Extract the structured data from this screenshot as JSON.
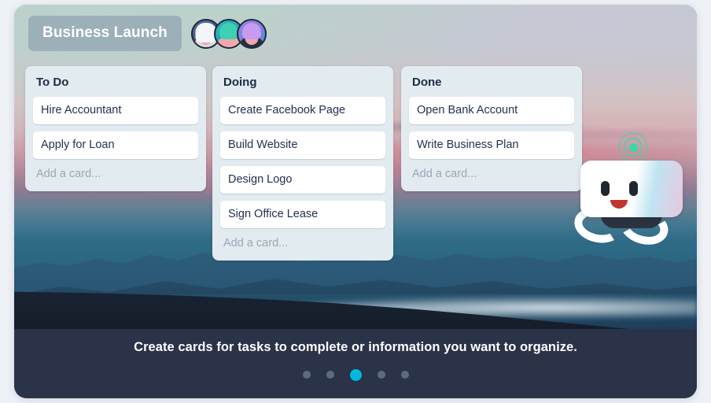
{
  "board": {
    "title": "Business Launch",
    "members": [
      {
        "name": "member-avatar-1"
      },
      {
        "name": "member-avatar-2"
      },
      {
        "name": "member-avatar-3"
      }
    ],
    "columns": [
      {
        "title": "To Do",
        "add_card_label": "Add a card...",
        "cards": [
          {
            "text": "Hire Accountant"
          },
          {
            "text": "Apply for Loan"
          }
        ]
      },
      {
        "title": "Doing",
        "add_card_label": "Add a card...",
        "cards": [
          {
            "text": "Create Facebook Page"
          },
          {
            "text": "Build Website"
          },
          {
            "text": "Design Logo"
          },
          {
            "text": "Sign Office Lease"
          }
        ]
      },
      {
        "title": "Done",
        "add_card_label": "Add a card...",
        "cards": [
          {
            "text": "Open Bank Account"
          },
          {
            "text": "Write Business Plan"
          }
        ]
      }
    ]
  },
  "mascot": {
    "name": "robot-mascot",
    "beacon_color": "#3ad7aa"
  },
  "footer": {
    "caption": "Create cards for tasks to complete or information you want to organize.",
    "pagination": {
      "total": 5,
      "active_index": 2,
      "active_color": "#00b8e0",
      "inactive_color": "#5d6b82"
    }
  },
  "theme": {
    "footer_bg": "#2b3348",
    "column_bg": "#e2ebf0",
    "card_bg": "#ffffff",
    "card_text": "#1f3050",
    "title_pill_bg": "rgba(126,145,166,.52)"
  }
}
